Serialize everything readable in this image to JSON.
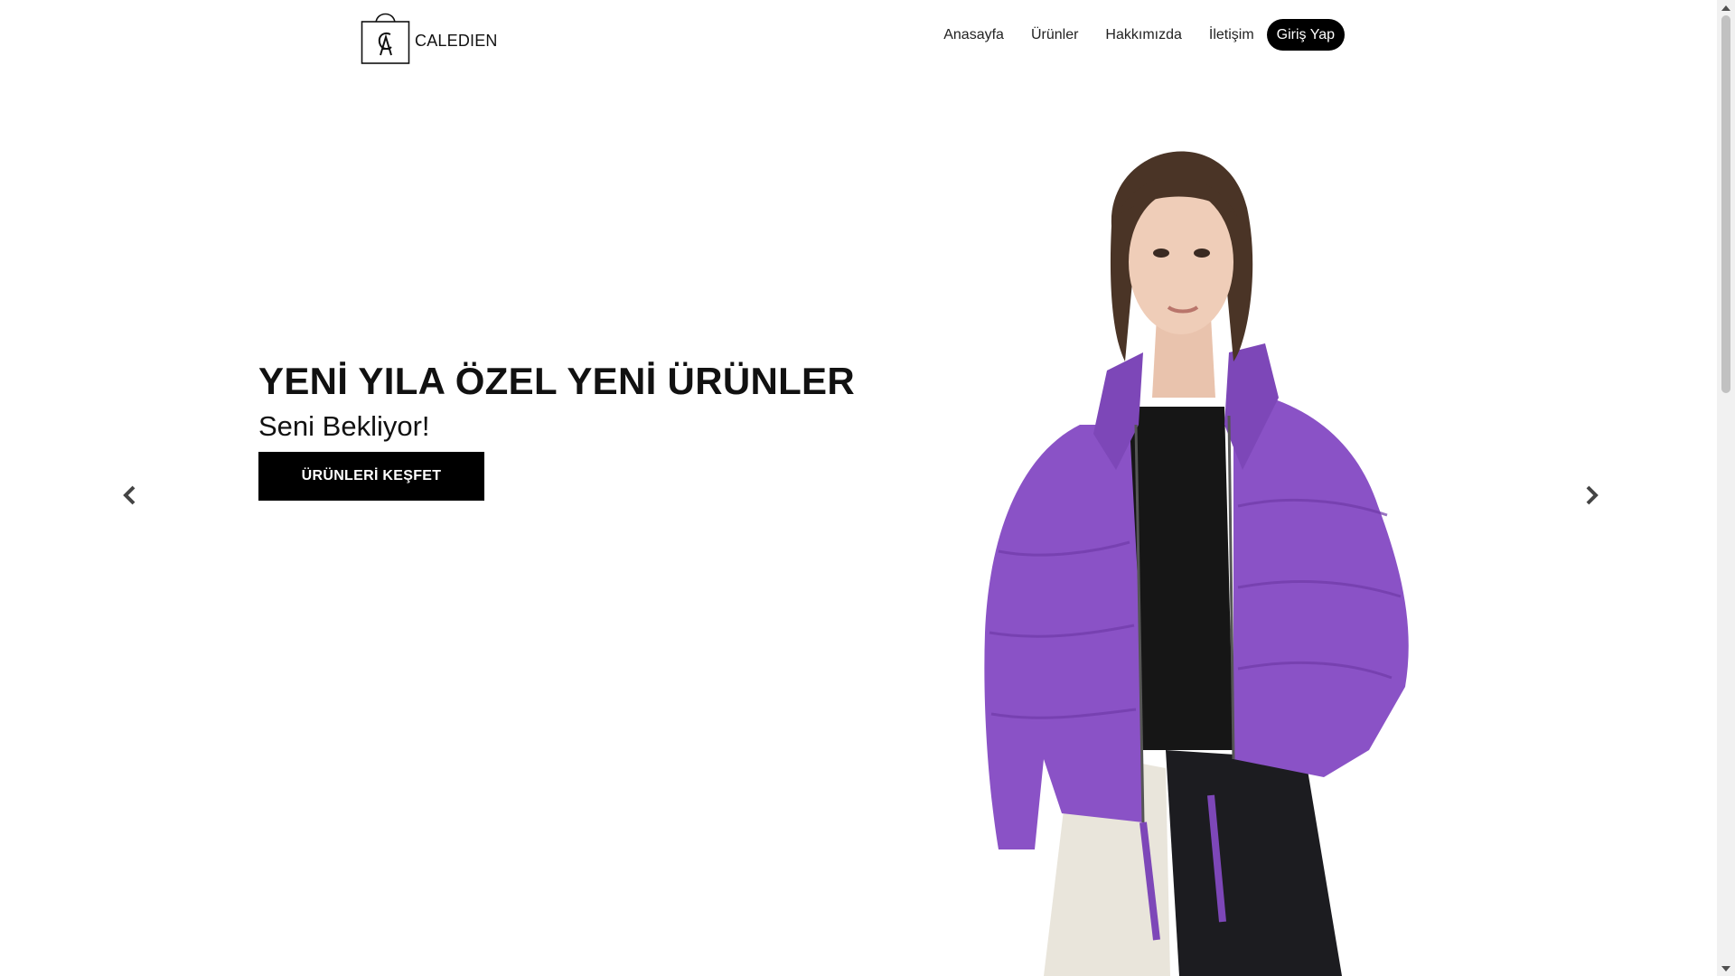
{
  "header": {
    "brand": "CALEDIEN",
    "logo_icon": "shopping-bag-logo-icon",
    "nav": [
      {
        "label": "Anasayfa"
      },
      {
        "label": "Ürünler"
      },
      {
        "label": "Hakkımızda"
      },
      {
        "label": "İletişim"
      }
    ],
    "login_label": "Giriş Yap"
  },
  "hero": {
    "title": "YENİ YILA ÖZEL YENİ ÜRÜNLER",
    "subtitle": "Seni Bekliyor!",
    "cta_label": "ÜRÜNLERİ KEŞFET",
    "prev_icon": "chevron-left-icon",
    "next_icon": "chevron-right-icon",
    "image": "model-in-purple-puffer-jacket"
  },
  "colors": {
    "primary": "#000000",
    "background": "#ffffff",
    "jacket": "#8a52c6"
  }
}
